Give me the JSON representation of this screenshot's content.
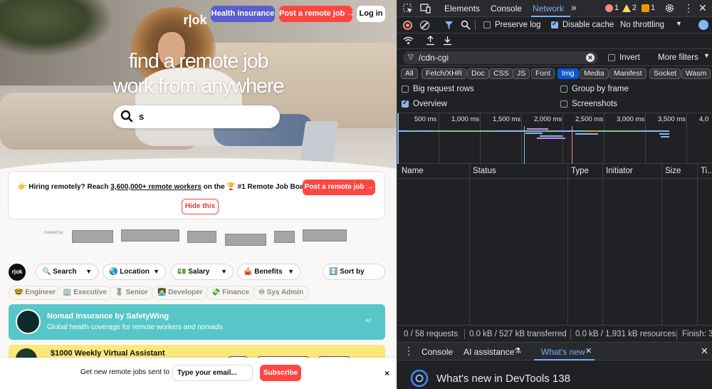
{
  "site": {
    "logo_text": "r|ok",
    "nav": {
      "health": "Health insurance",
      "post": "Post a remote job →",
      "login": "Log in"
    },
    "hero": {
      "line1_light": "find a",
      "line1_bold": "remote job",
      "line2_light": "work from",
      "line2_bold": "anywhere"
    },
    "search": {
      "value": "s"
    },
    "hire": {
      "prefix": "👉 Hiring remotely? Reach",
      "link": "3,600,000+ remote workers",
      "suffix": "on the 🏆 #1 Remote Job Board",
      "post_label": "Post a remote job →",
      "hide_label": "Hide this"
    },
    "trusted_by": "trusted by",
    "filters": [
      {
        "label": "🔍 Search"
      },
      {
        "label": "🌏 Location"
      },
      {
        "label": "💵 Salary"
      },
      {
        "label": "🎪 Benefits"
      }
    ],
    "sort": "↕️ Sort by",
    "tags": [
      "🤓 Engineer",
      "🏢 Executive",
      "🎖 Senior",
      "🧑‍💻 Developer",
      "💸 Finance",
      "♾ Sys Admin"
    ],
    "ad1": {
      "title": "Nomad Insurance by SafetyWing",
      "subtitle": "Global health coverage for remote workers and nomads",
      "badge": "Ad"
    },
    "ad2": {
      "title": "$1000 Weekly Virtual Assistant"
    },
    "subscribe": {
      "label": "Get new remote jobs sent to",
      "placeholder": "Type your email...",
      "button": "Subscribe",
      "close": "×"
    }
  },
  "devtools": {
    "tabs": [
      "Elements",
      "Console",
      "Network"
    ],
    "active_tab": "Network",
    "more": "»",
    "counts": {
      "errors": "1",
      "warnings": "2",
      "issues": "1"
    },
    "preserve_log": "Preserve log",
    "disable_cache": "Disable cache",
    "throttling": "No throttling",
    "filter_value": "/cdn-cgi",
    "invert": "Invert",
    "more_filters": "More filters",
    "types": [
      "All",
      "Fetch/XHR",
      "Doc",
      "CSS",
      "JS",
      "Font",
      "Img",
      "Media",
      "Manifest",
      "Socket",
      "Wasm"
    ],
    "active_type": "Img",
    "options": {
      "big_rows": "Big request rows",
      "group_by_frame": "Group by frame",
      "overview": "Overview",
      "screenshots": "Screenshots"
    },
    "ticks": [
      "500 ms",
      "1,000 ms",
      "1,500 ms",
      "2,000 ms",
      "2,500 ms",
      "3,000 ms",
      "3,500 ms",
      "4,0"
    ],
    "columns": [
      "Name",
      "Status",
      "Type",
      "Initiator",
      "Size",
      "Ti..."
    ],
    "status": {
      "requests": "0 / 58 requests",
      "transferred": "0.0 kB / 527 kB transferred",
      "resources": "0.0 kB / 1,931 kB resources",
      "finish": "Finish: 3"
    },
    "drawer_tabs": [
      "Console",
      "AI assistance",
      "What's new"
    ],
    "whats_new": "What's new in DevTools 138",
    "colors": {
      "bg": "#202124",
      "accent": "#7cacf8",
      "active_chip": "#0b57d0"
    }
  }
}
